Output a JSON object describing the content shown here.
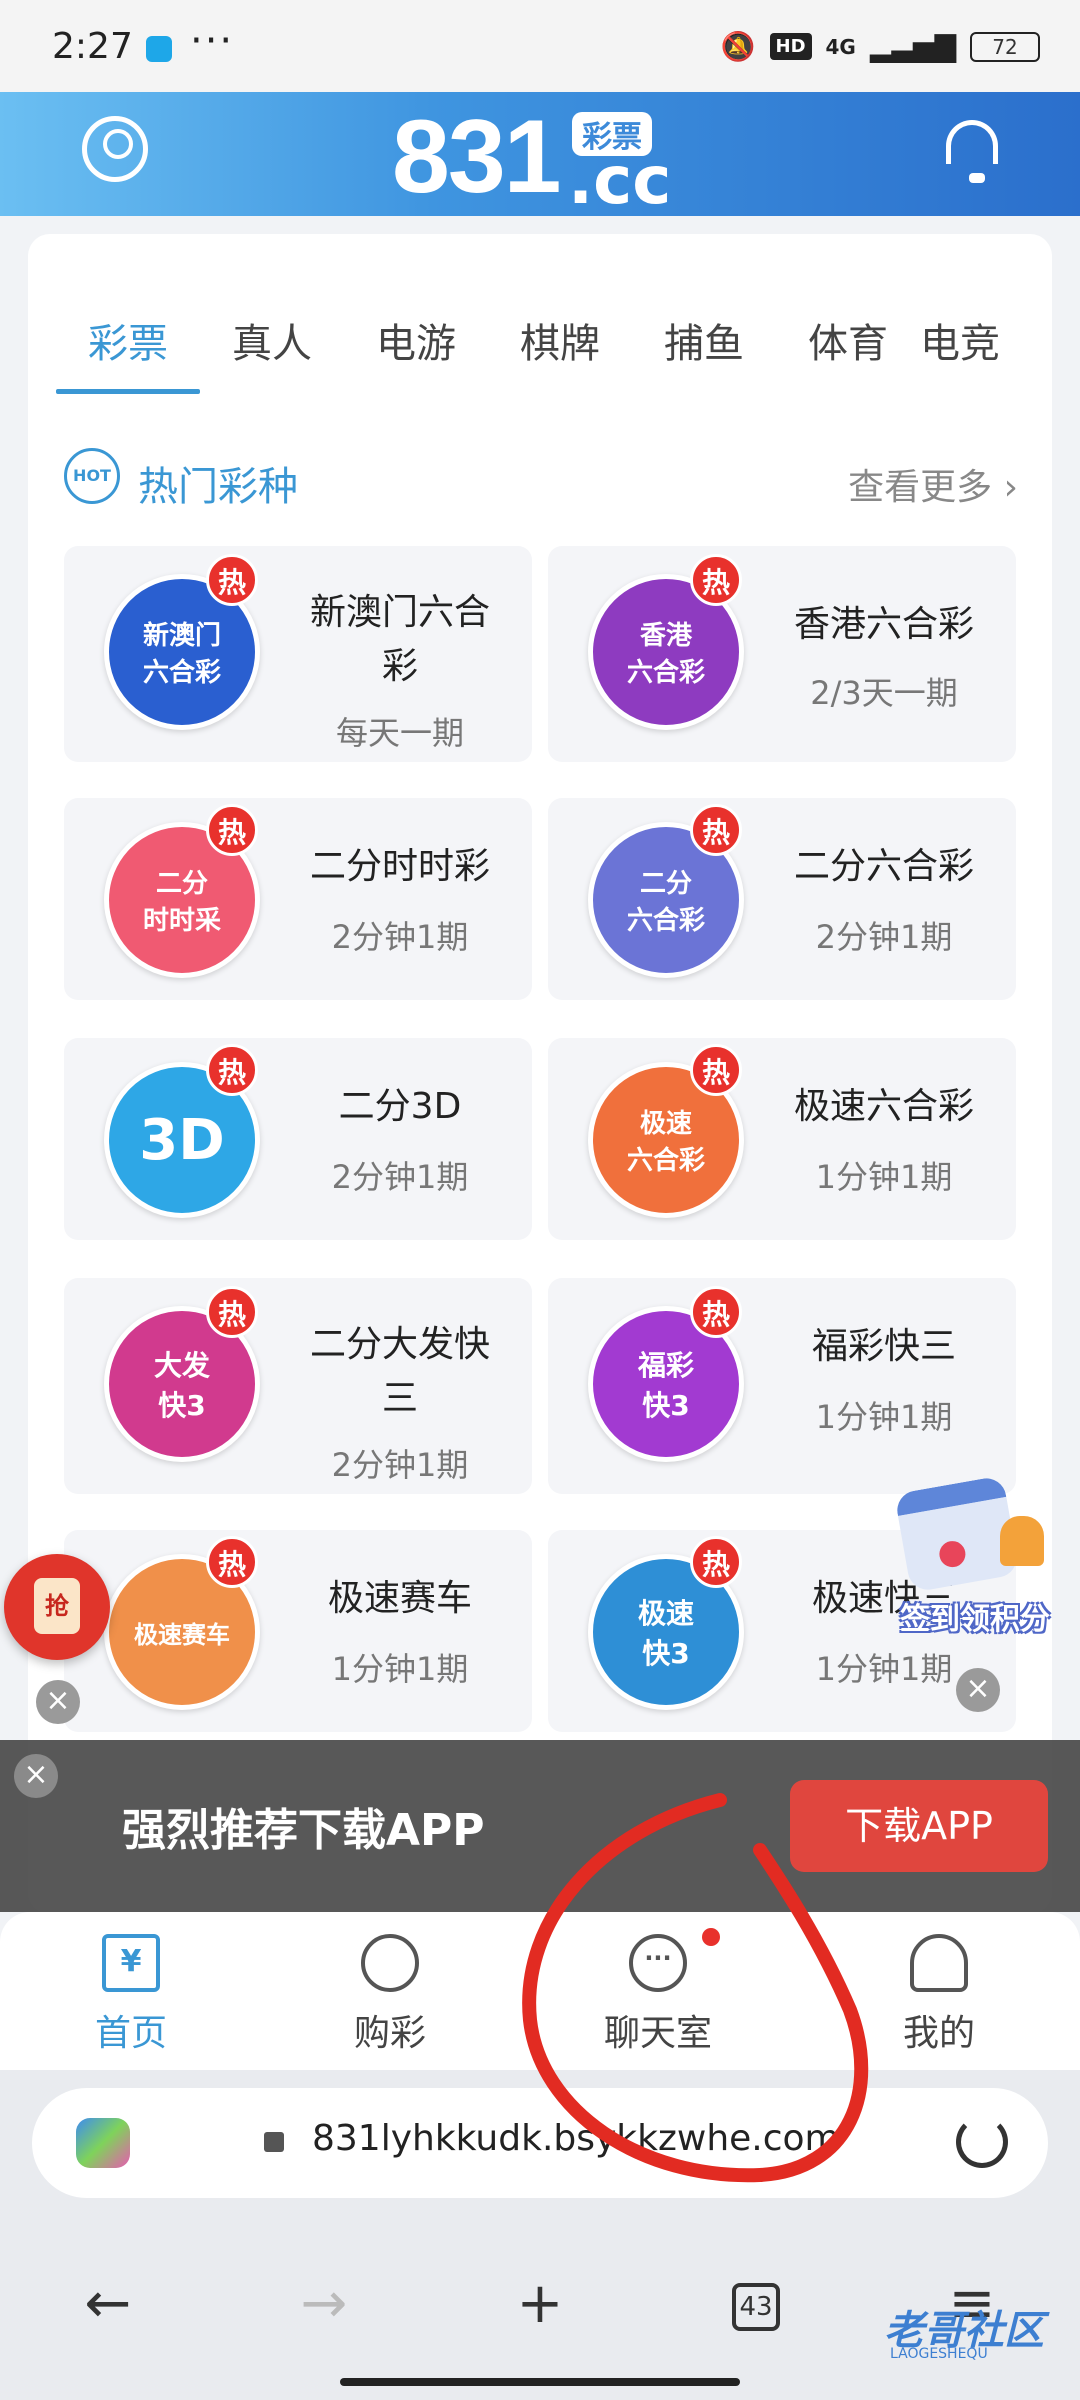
{
  "status_bar": {
    "time": "2:27",
    "dots": "···",
    "hd": "HD",
    "network": "4G",
    "battery": "72"
  },
  "header": {
    "logo": "831",
    "logo_tag": "彩票",
    "logo_sub": ".cc"
  },
  "tabs": [
    "彩票",
    "真人",
    "电游",
    "棋牌",
    "捕鱼",
    "体育",
    "电竞"
  ],
  "hot_section": {
    "title": "热门彩种",
    "more": "查看更多",
    "hot_icon": "HOT"
  },
  "hot_badge": "热",
  "games": [
    {
      "name": "新澳门六合彩",
      "period": "每天一期",
      "badge": "新澳门\n六合彩",
      "color": "#2a5fd0"
    },
    {
      "name": "香港六合彩",
      "period": "2/3天一期",
      "badge": "香港\n六合彩",
      "color": "#8e3bc0"
    },
    {
      "name": "二分时时彩",
      "period": "2分钟1期",
      "badge": "二分\n时时采",
      "color": "#f05a72"
    },
    {
      "name": "二分六合彩",
      "period": "2分钟1期",
      "badge": "二分\n六合彩",
      "color": "#6b74d6"
    },
    {
      "name": "二分3D",
      "period": "2分钟1期",
      "badge": "3D",
      "color": "#2ea7e6"
    },
    {
      "name": "极速六合彩",
      "period": "1分钟1期",
      "badge": "极速\n六合彩",
      "color": "#f0703c"
    },
    {
      "name": "二分大发快三",
      "period": "2分钟1期",
      "badge": "大发\n快3",
      "color": "#d13a8e"
    },
    {
      "name": "福彩快三",
      "period": "1分钟1期",
      "badge": "福彩\n快3",
      "color": "#a23ad1"
    },
    {
      "name": "极速赛车",
      "period": "1分钟1期",
      "badge": "极速赛车",
      "color": "#f0904a"
    },
    {
      "name": "极速快三",
      "period": "1分钟1期",
      "badge": "极速\n快3",
      "color": "#2e8fd6"
    }
  ],
  "floating": {
    "red_packet": "抢",
    "sign_in": "签到领积分",
    "close": "×"
  },
  "download_banner": {
    "text": "强烈推荐下载APP",
    "button": "下载APP",
    "close": "×"
  },
  "bottom_nav": [
    {
      "label": "首页"
    },
    {
      "label": "购彩"
    },
    {
      "label": "聊天室"
    },
    {
      "label": "我的"
    }
  ],
  "browser": {
    "url": "831lyhkkudk.bsykkzwhe.com",
    "tab_count": "43",
    "back": "←",
    "forward": "→",
    "new_tab": "+",
    "menu": "≡"
  },
  "watermark": {
    "text": "老哥社区",
    "sub": "LAOGESHEQU"
  },
  "colors": {
    "accent": "#3a97d4",
    "header_start": "#6bbff2",
    "header_end": "#2b6fcc",
    "hot": "#e8312c",
    "annotation": "#e22b22"
  }
}
